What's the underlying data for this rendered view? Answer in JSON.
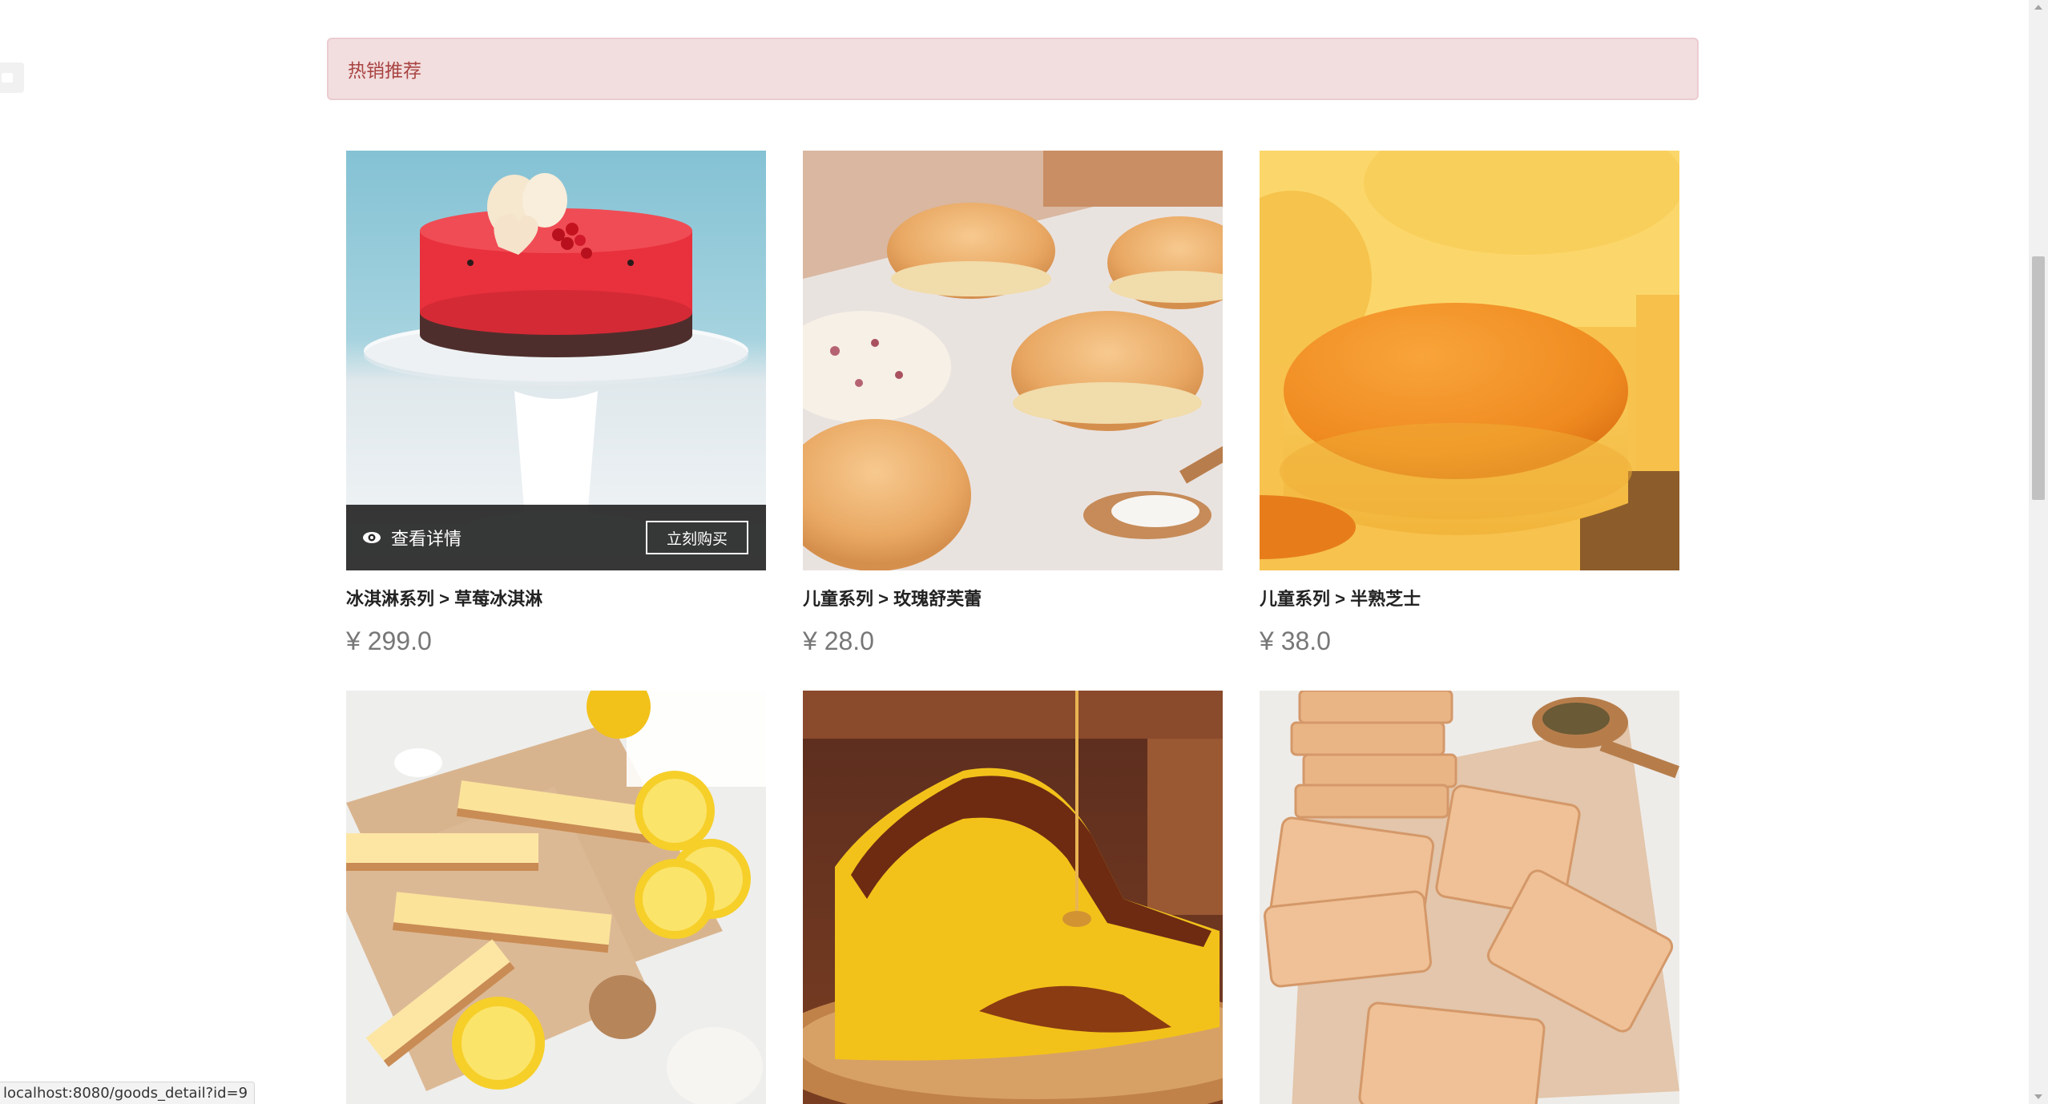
{
  "section": {
    "title": "热销推荐"
  },
  "products": [
    {
      "category": "冰淇淋系列",
      "name": "草莓冰淇淋",
      "full_name": "冰淇淋系列 > 草莓冰淇淋",
      "price": "¥ 299.0"
    },
    {
      "category": "儿童系列",
      "name": "玫瑰舒芙蕾",
      "full_name": "儿童系列 > 玫瑰舒芙蕾",
      "price": "¥ 28.0"
    },
    {
      "category": "儿童系列",
      "name": "半熟芝士",
      "full_name": "儿童系列 > 半熟芝士",
      "price": "¥ 38.0"
    },
    {
      "image": "lemon-cheese-bars"
    },
    {
      "image": "caramel-sponge-cake"
    },
    {
      "image": "sesame-crackers"
    }
  ],
  "overlay": {
    "detail_label": "查看详情",
    "buy_label": "立刻购买"
  },
  "status_bar": {
    "url": "localhost:8080/goods_detail?id=9"
  },
  "colors": {
    "section_bg": "#f2dede",
    "section_text": "#a94442",
    "price_text": "#777777",
    "overlay_bg": "#282828"
  },
  "icons": {
    "detail": "eye-icon"
  }
}
